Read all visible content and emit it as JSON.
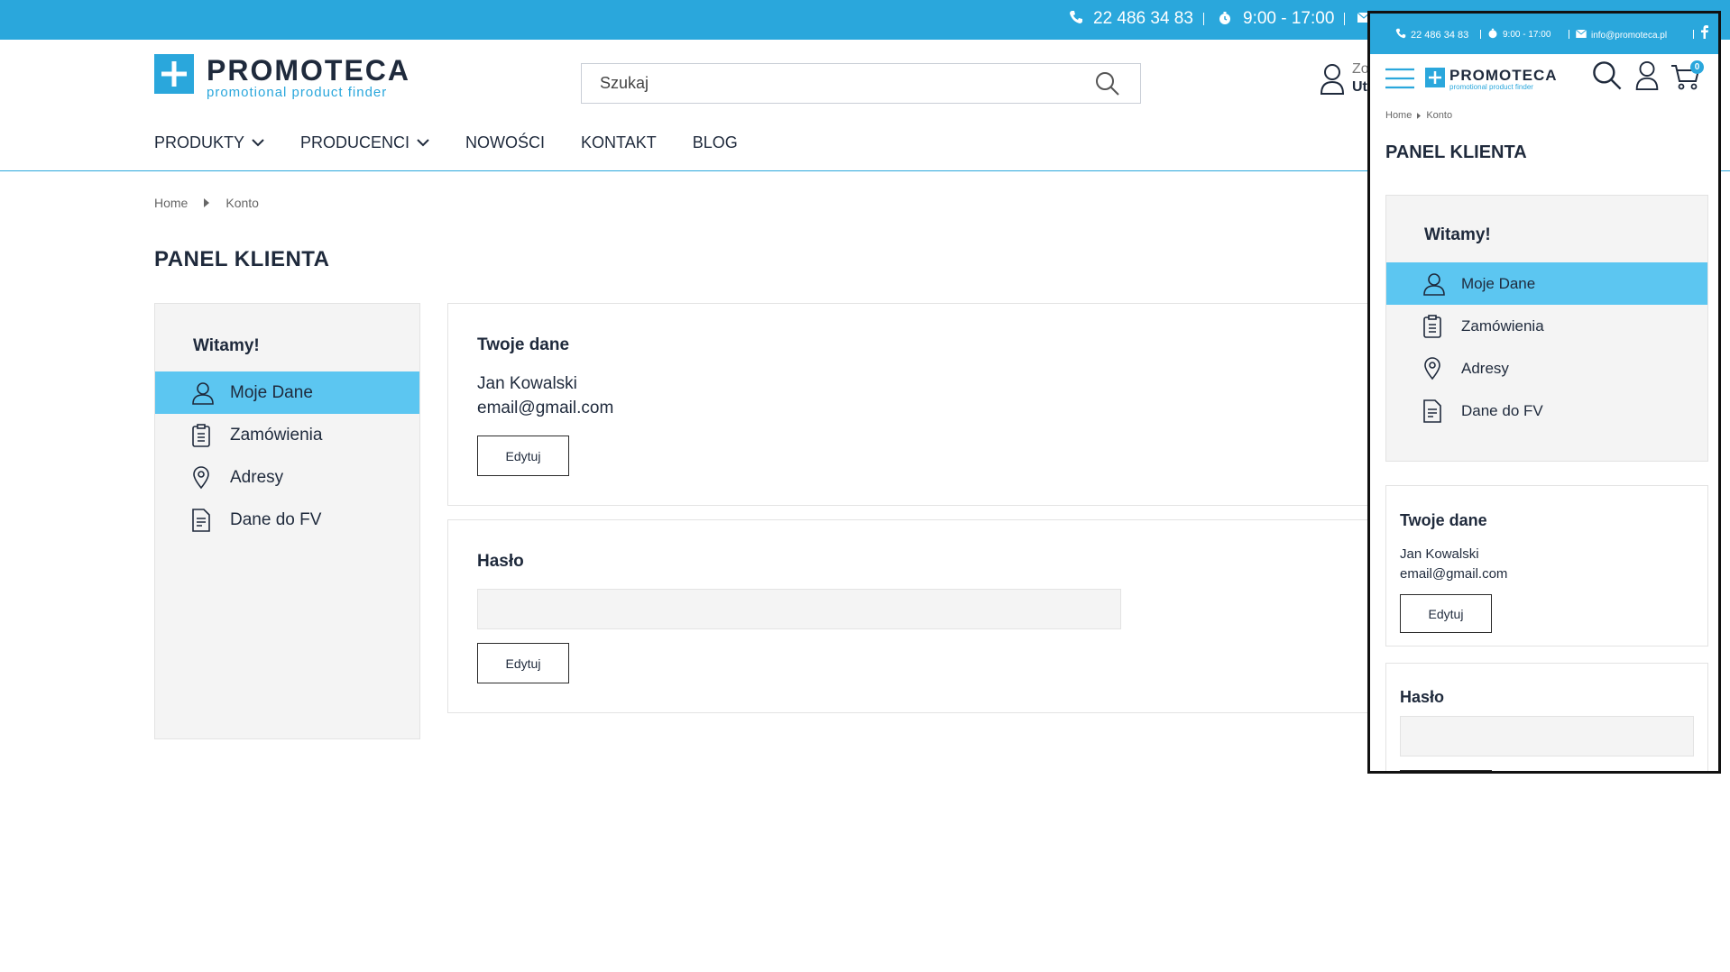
{
  "colors": {
    "accent": "#2aa7dc",
    "active_item": "#5cc6f1",
    "text": "#1f2a3c"
  },
  "topbar": {
    "phone": "22 486 34 83",
    "hours": "9:00 - 17:00"
  },
  "brand": {
    "name": "PROMOTECA",
    "tagline": "promotional product finder"
  },
  "search": {
    "placeholder": "Szukaj"
  },
  "user_area": {
    "line1": "Zo",
    "line2": "Ut"
  },
  "nav": {
    "produkty": "PRODUKTY",
    "producenci": "PRODUCENCI",
    "nowosci": "NOWOŚCI",
    "kontakt": "KONTAKT",
    "blog": "BLOG"
  },
  "breadcrumb": {
    "home": "Home",
    "current": "Konto"
  },
  "page_title": "PANEL KLIENTA",
  "sidebar": {
    "welcome": "Witamy!",
    "items": [
      {
        "label": "Moje Dane",
        "icon": "user-icon"
      },
      {
        "label": "Zamówienia",
        "icon": "clipboard-icon"
      },
      {
        "label": "Adresy",
        "icon": "map-pin-icon"
      },
      {
        "label": "Dane do FV",
        "icon": "invoice-icon"
      }
    ]
  },
  "details_card": {
    "title": "Twoje dane",
    "name": "Jan Kowalski",
    "email": "email@gmail.com",
    "edit_label": "Edytuj"
  },
  "password_card": {
    "title": "Hasło",
    "edit_label": "Edytuj"
  },
  "mobile": {
    "phone": "22 486 34 83",
    "hours": "9:00 - 17:00",
    "email": "info@promoteca.pl",
    "cart_count": "0"
  }
}
